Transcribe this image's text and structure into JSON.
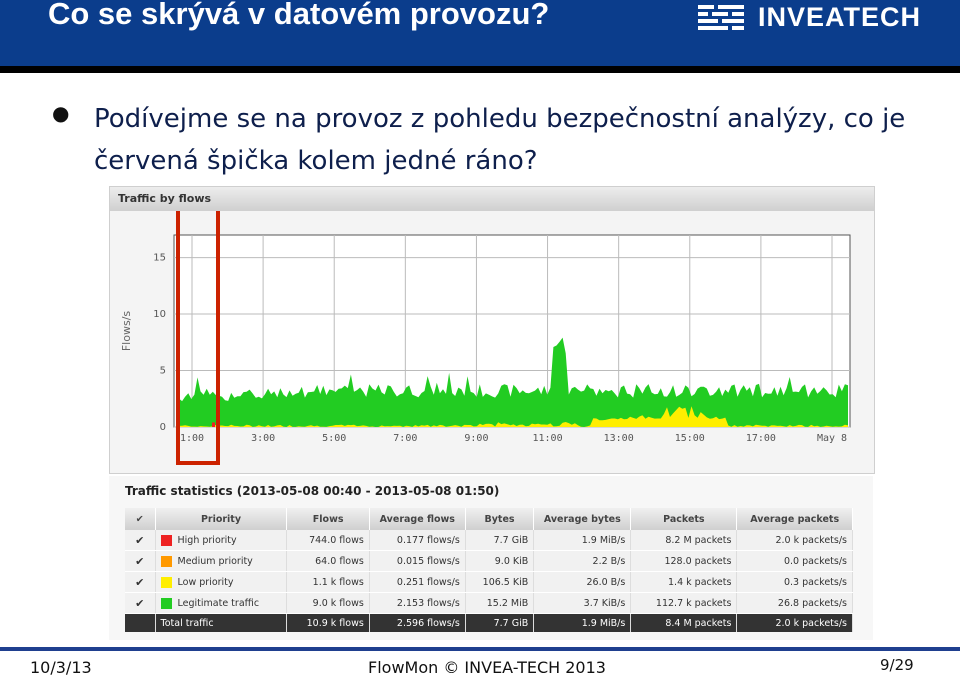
{
  "slide": {
    "title": "Co se skrývá v datovém provozu?",
    "logo_text": "INVEATECH",
    "bullet_text": "Podívejme se na provoz z pohledu bezpečnostní analýzy, co je červená špička kolem jedné ráno?"
  },
  "colors": {
    "header_bg": "#0b3d8c",
    "high": "#ee2222",
    "medium": "#ff9900",
    "low": "#ffee00",
    "legit": "#22cc22",
    "highlight": "#cc2200"
  },
  "graph": {
    "panel_title": "Traffic by flows",
    "ylabel": "Flows/s"
  },
  "chart_data": {
    "type": "area",
    "stacked": true,
    "title": "Traffic by flows",
    "ylabel": "Flows/s",
    "ylim": [
      0,
      17
    ],
    "yticks": [
      0,
      5,
      10,
      15
    ],
    "xticks": [
      "1:00",
      "3:00",
      "5:00",
      "7:00",
      "9:00",
      "11:00",
      "13:00",
      "15:00",
      "17:00",
      "May 8"
    ],
    "grid": true,
    "highlight_region": "1:00",
    "series": [
      {
        "name": "High priority",
        "color": "#ee2222",
        "peak": 0.4,
        "peak_at": "1:00"
      },
      {
        "name": "Low priority",
        "color": "#ffee00",
        "typical": 0.2,
        "peak": 1.8,
        "peak_at": "15:00"
      },
      {
        "name": "Legitimate traffic",
        "color": "#22cc22",
        "typical": 2.2,
        "peak": 7.0,
        "peak_at": "11:00"
      }
    ]
  },
  "stats": {
    "title": "Traffic statistics (2013-05-08 00:40 - 2013-05-08 01:50)",
    "headers": [
      "✔",
      "Priority",
      "Flows",
      "Average flows",
      "Bytes",
      "Average bytes",
      "Packets",
      "Average packets"
    ],
    "rows": [
      {
        "check": "✔",
        "label": "High priority",
        "color": "#ee2222",
        "flows": "744.0 flows",
        "avg_flows": "0.177 flows/s",
        "bytes": "7.7 GiB",
        "avg_bytes": "1.9 MiB/s",
        "packets": "8.2 M packets",
        "avg_packets": "2.0 k packets/s"
      },
      {
        "check": "✔",
        "label": "Medium priority",
        "color": "#ff9900",
        "flows": "64.0 flows",
        "avg_flows": "0.015 flows/s",
        "bytes": "9.0 KiB",
        "avg_bytes": "2.2 B/s",
        "packets": "128.0 packets",
        "avg_packets": "0.0 packets/s"
      },
      {
        "check": "✔",
        "label": "Low priority",
        "color": "#ffee00",
        "flows": "1.1 k flows",
        "avg_flows": "0.251 flows/s",
        "bytes": "106.5 KiB",
        "avg_bytes": "26.0 B/s",
        "packets": "1.4 k packets",
        "avg_packets": "0.3 packets/s"
      },
      {
        "check": "✔",
        "label": "Legitimate traffic",
        "color": "#22cc22",
        "flows": "9.0 k flows",
        "avg_flows": "2.153 flows/s",
        "bytes": "15.2 MiB",
        "avg_bytes": "3.7 KiB/s",
        "packets": "112.7 k packets",
        "avg_packets": "26.8 packets/s"
      }
    ],
    "total": {
      "label": "Total traffic",
      "flows": "10.9 k flows",
      "avg_flows": "2.596 flows/s",
      "bytes": "7.7 GiB",
      "avg_bytes": "1.9 MiB/s",
      "packets": "8.4 M packets",
      "avg_packets": "2.0 k packets/s"
    }
  },
  "footer": {
    "date": "10/3/13",
    "center": "FlowMon © INVEA-TECH 2013",
    "page": "9/29"
  }
}
